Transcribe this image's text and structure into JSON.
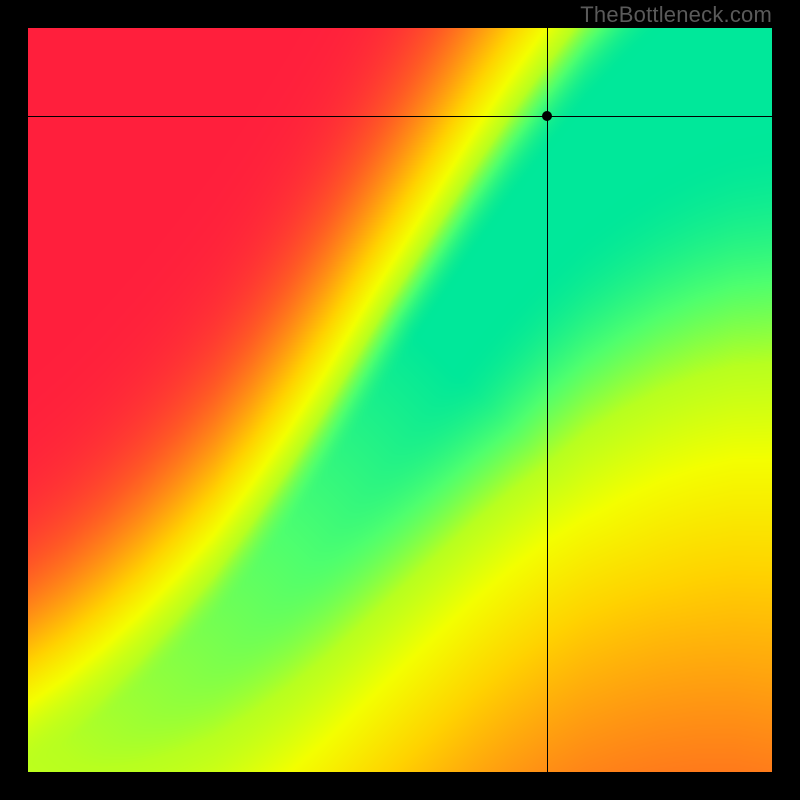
{
  "watermark": "TheBottleneck.com",
  "chart_data": {
    "type": "heatmap",
    "title": "",
    "xlabel": "",
    "ylabel": "",
    "xlim": [
      0,
      1
    ],
    "ylim": [
      0,
      1
    ],
    "grid": false,
    "legend": false,
    "crosshair": {
      "x": 0.698,
      "y": 0.118
    },
    "marker": {
      "x": 0.698,
      "y": 0.118
    },
    "colormap": {
      "stops": [
        {
          "t": 0.0,
          "color": "#ff1f3d"
        },
        {
          "t": 0.2,
          "color": "#ff5a25"
        },
        {
          "t": 0.4,
          "color": "#ff9a12"
        },
        {
          "t": 0.58,
          "color": "#ffd400"
        },
        {
          "t": 0.74,
          "color": "#f4ff00"
        },
        {
          "t": 0.86,
          "color": "#b8ff20"
        },
        {
          "t": 0.94,
          "color": "#4dff70"
        },
        {
          "t": 1.0,
          "color": "#00e89a"
        }
      ]
    },
    "ridge": {
      "xs": [
        0.0,
        0.05,
        0.1,
        0.15,
        0.2,
        0.25,
        0.3,
        0.35,
        0.4,
        0.45,
        0.5,
        0.55,
        0.6,
        0.65,
        0.7,
        0.75,
        0.8,
        0.85,
        0.9,
        0.95,
        1.0
      ],
      "ys": [
        1.0,
        0.975,
        0.945,
        0.91,
        0.87,
        0.825,
        0.77,
        0.71,
        0.645,
        0.575,
        0.505,
        0.435,
        0.365,
        0.3,
        0.24,
        0.185,
        0.14,
        0.1,
        0.065,
        0.035,
        0.01
      ],
      "width": [
        0.005,
        0.008,
        0.012,
        0.016,
        0.02,
        0.024,
        0.028,
        0.033,
        0.038,
        0.043,
        0.048,
        0.054,
        0.06,
        0.066,
        0.072,
        0.08,
        0.088,
        0.096,
        0.105,
        0.115,
        0.13
      ]
    },
    "falloff_scale": 0.4,
    "description": "Heatmap with a narrow optimal (green) diagonal band curving from bottom-left to top-right; left region is red (bad), right of band grades through orange/yellow. Black crosshair and dot mark a selected point slightly left/below the green band near the top-right region."
  }
}
